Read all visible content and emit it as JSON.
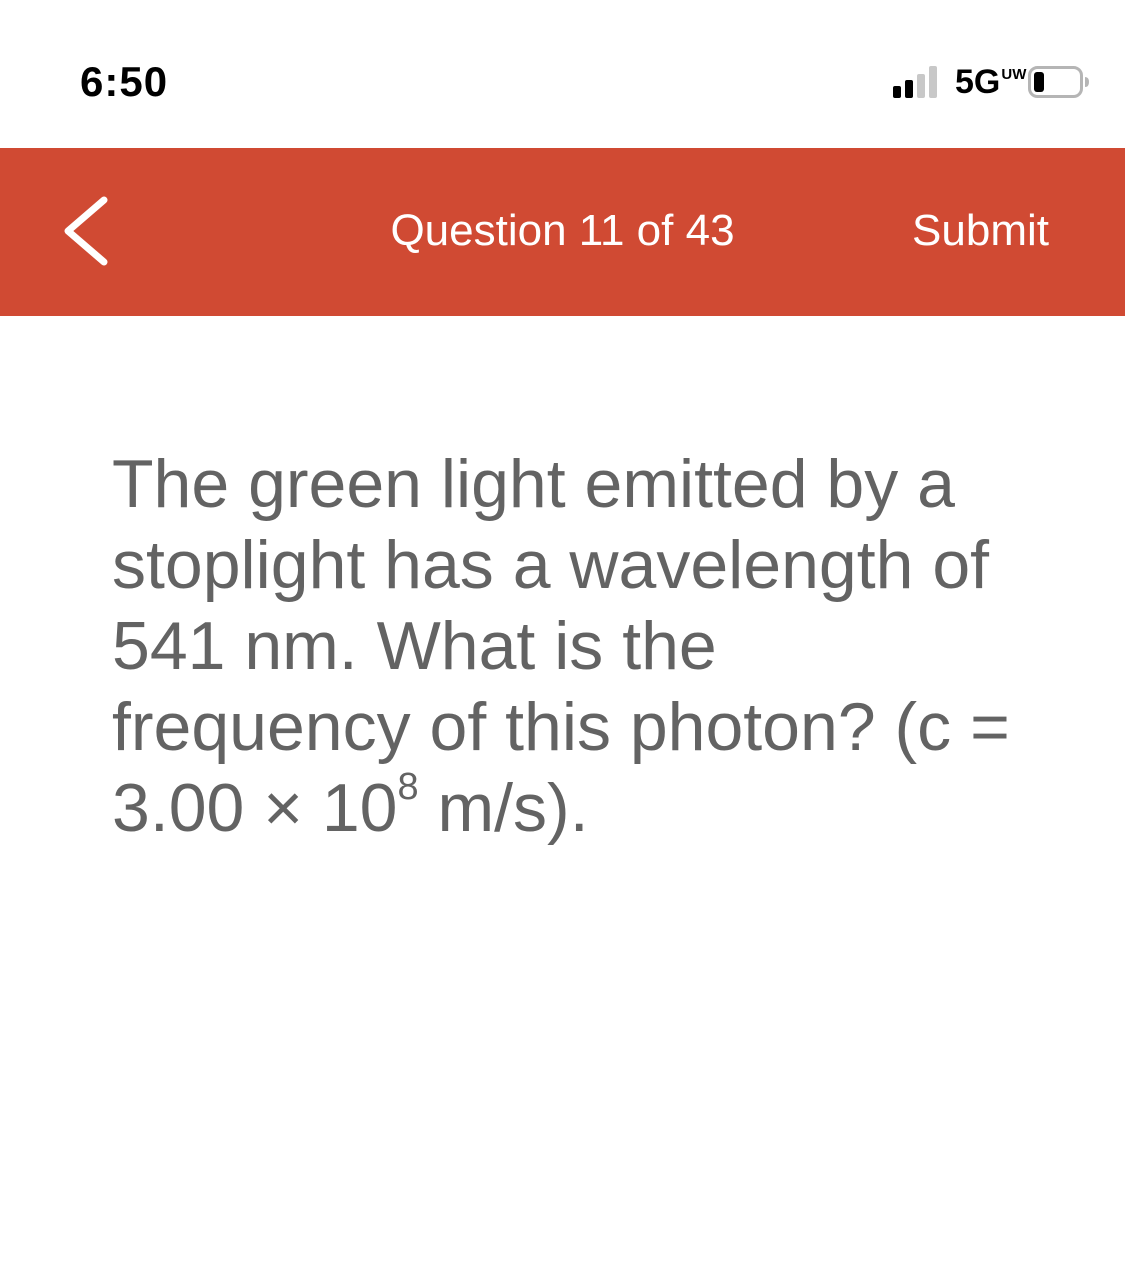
{
  "status_bar": {
    "time": "6:50",
    "network": "5G",
    "network_sub": "UW",
    "icons": [
      "signal-bars-icon",
      "battery-icon"
    ]
  },
  "header": {
    "title": "Question 11 of 43",
    "submit_label": "Submit",
    "back_icon": "chevron-left-icon",
    "background_color": "#d04a33",
    "text_color": "#ffffff"
  },
  "question": {
    "text_before_exponent": "The green light emitted by a stoplight has a wavelength of 541 nm. What is the frequency of this photon? (c = 3.00 × 10",
    "exponent": "8",
    "text_after_exponent": " m/s).",
    "text_color": "#636363"
  }
}
